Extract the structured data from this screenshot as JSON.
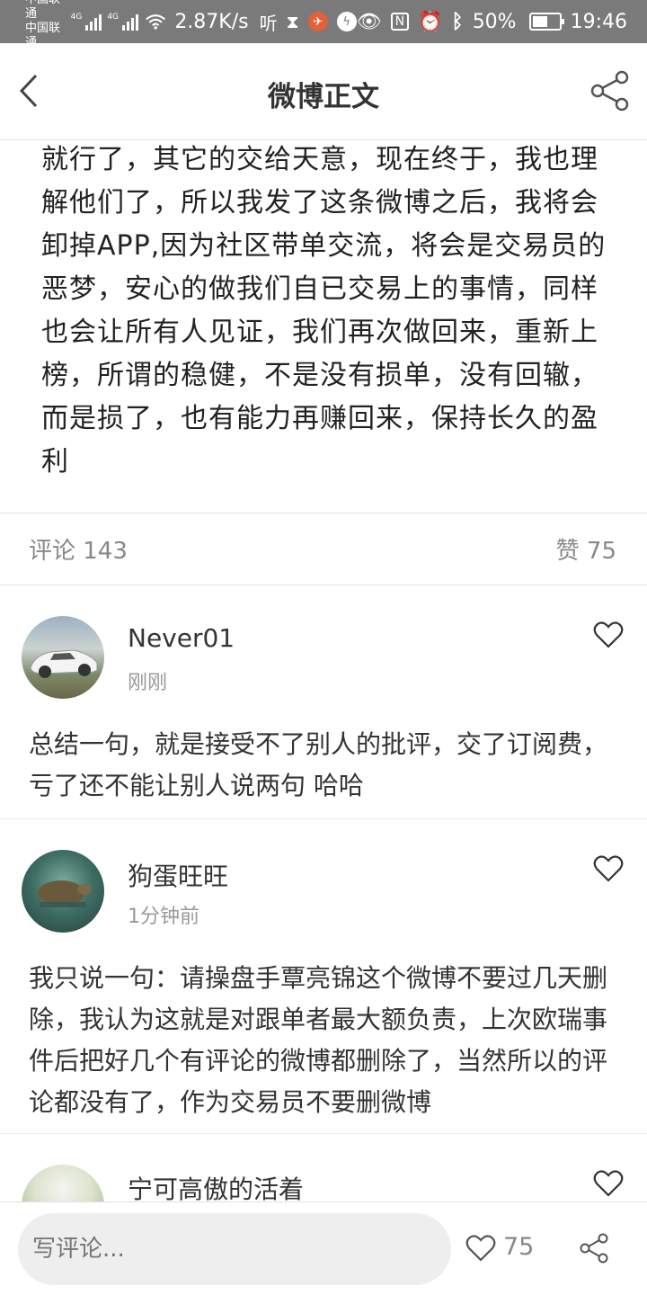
{
  "status_bar": {
    "carrier_1": "中国联通",
    "carrier_2": "中国联通",
    "net_1": "4G",
    "net_2": "4G",
    "speed": "2.87K/s",
    "battery": "50%",
    "time": "19:46",
    "icons": [
      "signal-icon",
      "signal-icon",
      "wifi-icon",
      "hd-voice-icon",
      "hourglass-icon",
      "app-notification-icon",
      "app-notification-icon",
      "eye-icon",
      "nfc-icon",
      "alarm-icon",
      "bluetooth-icon",
      "battery-icon"
    ]
  },
  "header": {
    "title": "微博正文",
    "back_icon": "chevron-left-icon",
    "share_icon": "share-icon"
  },
  "article": {
    "text": "就行了，其它的交给天意，现在终于，我也理解他们了，所以我发了这条微博之后，我将会卸掉APP,因为社区带单交流，将会是交易员的恶梦，安心的做我们自已交易上的事情，同样也会让所有人见证，我们再次做回来，重新上榜，所谓的稳健，不是没有损单，没有回辙，而是损了，也有能力再赚回来，保持长久的盈利"
  },
  "stats": {
    "comments_label": "评论 143",
    "likes_label": "赞 75"
  },
  "comments": [
    {
      "name": "Never01",
      "time": "刚刚",
      "text": "总结一句，就是接受不了别人的批评，交了订阅费，亏了还不能让别人说两句 哈哈"
    },
    {
      "name": "狗蛋旺旺",
      "time": "1分钟前",
      "text": "我只说一句：请操盘手覃亮锦这个微博不要过几天删除，我认为这就是对跟单者最大额负责，上次欧瑞事件后把好几个有评论的微博都删除了，当然所以的评论都没有了，作为交易员不要删微博"
    },
    {
      "name": "宁可高傲的活着",
      "time": "",
      "text": ""
    }
  ],
  "bottom_bar": {
    "input_placeholder": "写评论...",
    "like_count": "75"
  },
  "colors": {
    "status_bar_bg": "#7a7a7a",
    "text_primary": "#333333",
    "text_secondary": "#999999",
    "input_bg": "#eeeeee"
  }
}
